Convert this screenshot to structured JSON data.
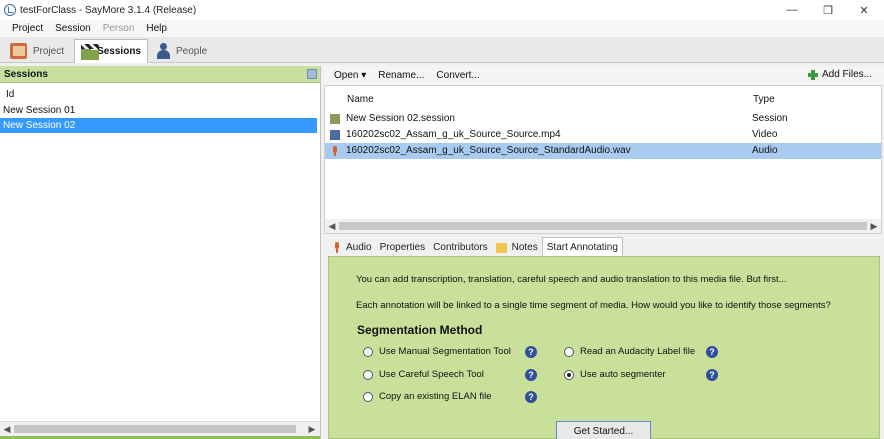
{
  "window": {
    "title": "testForClass - SayMore 3.1.4 (Release)",
    "minimize": "—",
    "maximize": "❐",
    "close": "✕"
  },
  "menu": {
    "items": [
      {
        "label": "Project",
        "enabled": true
      },
      {
        "label": "Session",
        "enabled": true
      },
      {
        "label": "Person",
        "enabled": false
      },
      {
        "label": "Help",
        "enabled": true
      }
    ]
  },
  "main_tabs": [
    {
      "label": "Project",
      "icon": "project-icon",
      "active": false
    },
    {
      "label": "Sessions",
      "icon": "sessions-icon",
      "active": true
    },
    {
      "label": "People",
      "icon": "people-icon",
      "active": false
    }
  ],
  "sessions_panel": {
    "header": "Sessions",
    "column": "Id",
    "rows": [
      {
        "id": "New Session 01",
        "selected": false
      },
      {
        "id": "New Session 02",
        "selected": true
      }
    ]
  },
  "file_toolbar": {
    "open": "Open ▾",
    "rename": "Rename...",
    "convert": "Convert...",
    "add_files": "Add Files..."
  },
  "file_list": {
    "columns": {
      "name": "Name",
      "type": "Type"
    },
    "rows": [
      {
        "name": "New Session 02.session",
        "type": "Session",
        "icon": "session-file-icon",
        "selected": false
      },
      {
        "name": "160202sc02_Assam_g_uk_Source_Source.mp4",
        "type": "Video",
        "icon": "video-file-icon",
        "selected": false
      },
      {
        "name": "160202sc02_Assam_g_uk_Source_Source_StandardAudio.wav",
        "type": "Audio",
        "icon": "audio-file-icon",
        "selected": true
      }
    ]
  },
  "sub_tabs": [
    {
      "label": "Audio",
      "active": false
    },
    {
      "label": "Properties",
      "active": false
    },
    {
      "label": "Contributors",
      "active": false
    },
    {
      "label": "Notes",
      "active": false
    },
    {
      "label": "Start Annotating",
      "active": true
    }
  ],
  "annotating": {
    "intro": "You can add transcription, translation, careful speech and audio translation to this media file. But first...",
    "question": "Each annotation will be linked to a single time segment of media. How would you like to identify those segments?",
    "segmentation_title": "Segmentation Method",
    "options": [
      {
        "label": "Use Manual Segmentation Tool",
        "selected": false
      },
      {
        "label": "Use Careful Speech Tool",
        "selected": false
      },
      {
        "label": "Copy an existing ELAN file",
        "selected": false
      },
      {
        "label": "Read an Audacity Label file",
        "selected": false
      },
      {
        "label": "Use auto segmenter",
        "selected": true
      }
    ],
    "help_glyph": "?",
    "get_started": "Get Started..."
  },
  "colors": {
    "selection_blue": "#3399ff",
    "row_highlight": "#a9cbf0",
    "panel_green": "#c9e09b",
    "header_green": "#c8dfa0"
  }
}
